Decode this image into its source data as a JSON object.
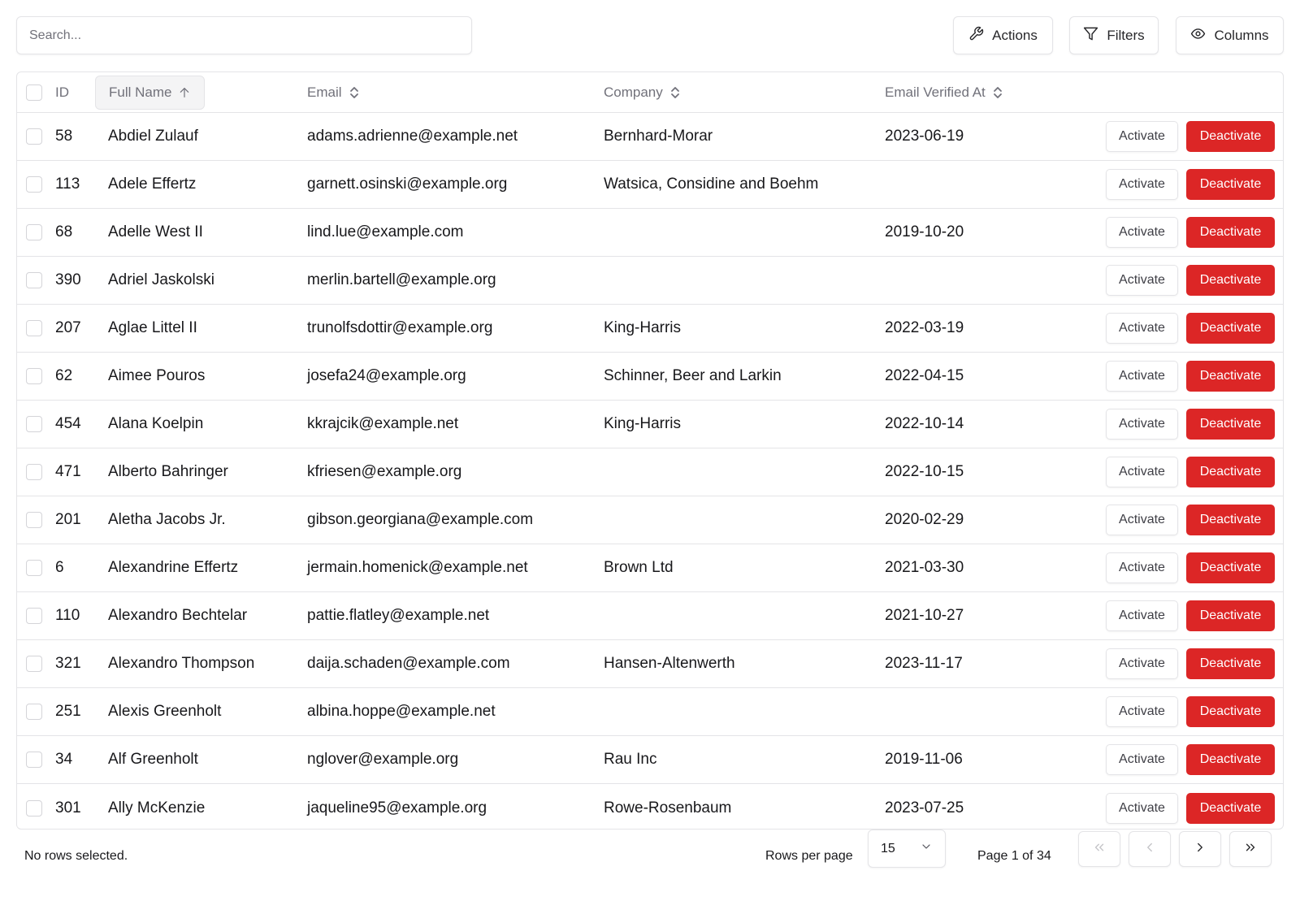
{
  "toolbar": {
    "search_placeholder": "Search...",
    "search_value": "",
    "actions_label": "Actions",
    "filters_label": "Filters",
    "columns_label": "Columns",
    "actions_icon": "wrench-icon",
    "filters_icon": "filter-icon",
    "columns_icon": "eye-icon"
  },
  "table": {
    "columns": [
      {
        "key": "id",
        "label": "ID",
        "sort": "none"
      },
      {
        "key": "full_name",
        "label": "Full Name",
        "sort": "ascending"
      },
      {
        "key": "email",
        "label": "Email",
        "sort": "unsorted"
      },
      {
        "key": "company",
        "label": "Company",
        "sort": "unsorted"
      },
      {
        "key": "email_verified_at",
        "label": "Email Verified At",
        "sort": "unsorted"
      }
    ],
    "row_actions": {
      "activate": "Activate",
      "deactivate": "Deactivate"
    },
    "rows": [
      {
        "id": "58",
        "name": "Abdiel Zulauf",
        "email": "adams.adrienne@example.net",
        "company": "Bernhard-Morar",
        "verified": "2023-06-19"
      },
      {
        "id": "113",
        "name": "Adele Effertz",
        "email": "garnett.osinski@example.org",
        "company": "Watsica, Considine and Boehm",
        "verified": ""
      },
      {
        "id": "68",
        "name": "Adelle West II",
        "email": "lind.lue@example.com",
        "company": "",
        "verified": "2019-10-20"
      },
      {
        "id": "390",
        "name": "Adriel Jaskolski",
        "email": "merlin.bartell@example.org",
        "company": "",
        "verified": ""
      },
      {
        "id": "207",
        "name": "Aglae Littel II",
        "email": "trunolfsdottir@example.org",
        "company": "King-Harris",
        "verified": "2022-03-19"
      },
      {
        "id": "62",
        "name": "Aimee Pouros",
        "email": "josefa24@example.org",
        "company": "Schinner, Beer and Larkin",
        "verified": "2022-04-15"
      },
      {
        "id": "454",
        "name": "Alana Koelpin",
        "email": "kkrajcik@example.net",
        "company": "King-Harris",
        "verified": "2022-10-14"
      },
      {
        "id": "471",
        "name": "Alberto Bahringer",
        "email": "kfriesen@example.org",
        "company": "",
        "verified": "2022-10-15"
      },
      {
        "id": "201",
        "name": "Aletha Jacobs Jr.",
        "email": "gibson.georgiana@example.com",
        "company": "",
        "verified": "2020-02-29"
      },
      {
        "id": "6",
        "name": "Alexandrine Effertz",
        "email": "jermain.homenick@example.net",
        "company": "Brown Ltd",
        "verified": "2021-03-30"
      },
      {
        "id": "110",
        "name": "Alexandro Bechtelar",
        "email": "pattie.flatley@example.net",
        "company": "",
        "verified": "2021-10-27"
      },
      {
        "id": "321",
        "name": "Alexandro Thompson",
        "email": "daija.schaden@example.com",
        "company": "Hansen-Altenwerth",
        "verified": "2023-11-17"
      },
      {
        "id": "251",
        "name": "Alexis Greenholt",
        "email": "albina.hoppe@example.net",
        "company": "",
        "verified": ""
      },
      {
        "id": "34",
        "name": "Alf Greenholt",
        "email": "nglover@example.org",
        "company": "Rau Inc",
        "verified": "2019-11-06"
      },
      {
        "id": "301",
        "name": "Ally McKenzie",
        "email": "jaqueline95@example.org",
        "company": "Rowe-Rosenbaum",
        "verified": "2023-07-25"
      }
    ]
  },
  "footer": {
    "selection_text": "No rows selected.",
    "rows_per_page_label": "Rows per page",
    "rows_per_page_value": "15",
    "page_info": "Page 1 of 34",
    "pagination": {
      "first": {
        "icon": "chevrons-left-icon",
        "enabled": false
      },
      "prev": {
        "icon": "chevron-left-icon",
        "enabled": false
      },
      "next": {
        "icon": "chevron-right-icon",
        "enabled": true
      },
      "last": {
        "icon": "chevrons-right-icon",
        "enabled": true
      }
    }
  },
  "colors": {
    "destructive": "#dc2626",
    "border": "#e4e4e7",
    "muted_text": "#71717a",
    "text": "#18181b"
  }
}
